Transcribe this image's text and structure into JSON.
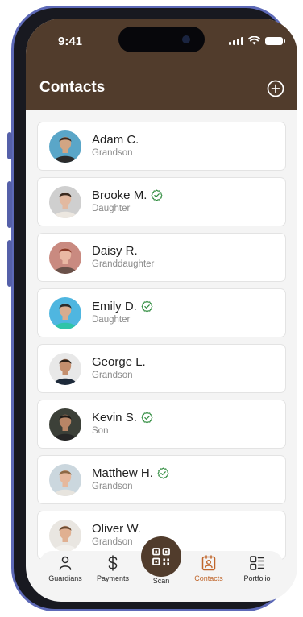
{
  "status_bar": {
    "time": "9:41"
  },
  "header": {
    "title": "Contacts",
    "add_icon": "plus-circle-icon"
  },
  "contacts": [
    {
      "name": "Adam C.",
      "relation": "Grandson",
      "verified": false,
      "avatar_bg": "#5aa6c8",
      "skin": "#d2a583",
      "hair": "#3b2a20",
      "shirt": "#2b2b2b"
    },
    {
      "name": "Brooke M.",
      "relation": "Daughter",
      "verified": true,
      "avatar_bg": "#cfcfcf",
      "skin": "#e2b9a0",
      "hair": "#3a2a1f",
      "shirt": "#ece7e0"
    },
    {
      "name": "Daisy R.",
      "relation": "Granddaughter",
      "verified": false,
      "avatar_bg": "#c98a80",
      "skin": "#e9b8a3",
      "hair": "#8a3a28",
      "shirt": "#6a5149"
    },
    {
      "name": "Emily D.",
      "relation": "Daughter",
      "verified": true,
      "avatar_bg": "#4fb6e0",
      "skin": "#d8ac8f",
      "hair": "#2b2b2b",
      "shirt": "#2fc4a8"
    },
    {
      "name": "George L.",
      "relation": "Grandson",
      "verified": false,
      "avatar_bg": "#e8e8e8",
      "skin": "#c48f6e",
      "hair": "#2c2018",
      "shirt": "#1d2a3a"
    },
    {
      "name": "Kevin S.",
      "relation": "Son",
      "verified": true,
      "avatar_bg": "#3c4038",
      "skin": "#b88566",
      "hair": "#1e1a17",
      "shirt": "#262626"
    },
    {
      "name": "Matthew H.",
      "relation": "Grandson",
      "verified": true,
      "avatar_bg": "#cbd7de",
      "skin": "#e6b89c",
      "hair": "#8d6844",
      "shirt": "#e7e4de"
    },
    {
      "name": "Oliver W.",
      "relation": "Grandson",
      "verified": false,
      "avatar_bg": "#e9e6e1",
      "skin": "#e0b091",
      "hair": "#6b4a30",
      "shirt": "#f2f0ec"
    }
  ],
  "nav": {
    "guardians": "Guardians",
    "payments": "Payments",
    "scan": "Scan",
    "contacts": "Contacts",
    "portfolio": "Portfolio",
    "active": "Contacts"
  },
  "colors": {
    "header_brown": "#513c2c",
    "accent_orange": "#c0652a",
    "verified_green": "#2e8b3d"
  }
}
